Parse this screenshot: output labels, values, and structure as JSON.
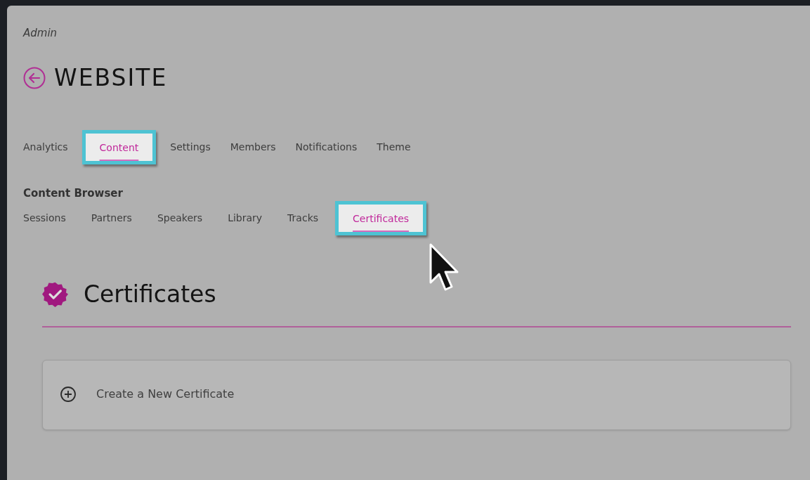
{
  "breadcrumb": "Admin",
  "title": "WEBSITE",
  "tabs": [
    {
      "label": "Analytics",
      "selected": false
    },
    {
      "label": "Content",
      "selected": true
    },
    {
      "label": "Settings",
      "selected": false
    },
    {
      "label": "Members",
      "selected": false
    },
    {
      "label": "Notifications",
      "selected": false
    },
    {
      "label": "Theme",
      "selected": false
    }
  ],
  "content_browser": {
    "heading": "Content Browser",
    "tabs": [
      {
        "label": "Sessions",
        "selected": false
      },
      {
        "label": "Partners",
        "selected": false
      },
      {
        "label": "Speakers",
        "selected": false
      },
      {
        "label": "Library",
        "selected": false
      },
      {
        "label": "Tracks",
        "selected": false
      },
      {
        "label": "Certificates",
        "selected": true
      }
    ]
  },
  "section": {
    "title": "Certificates",
    "create_label": "Create a New Certificate"
  }
}
